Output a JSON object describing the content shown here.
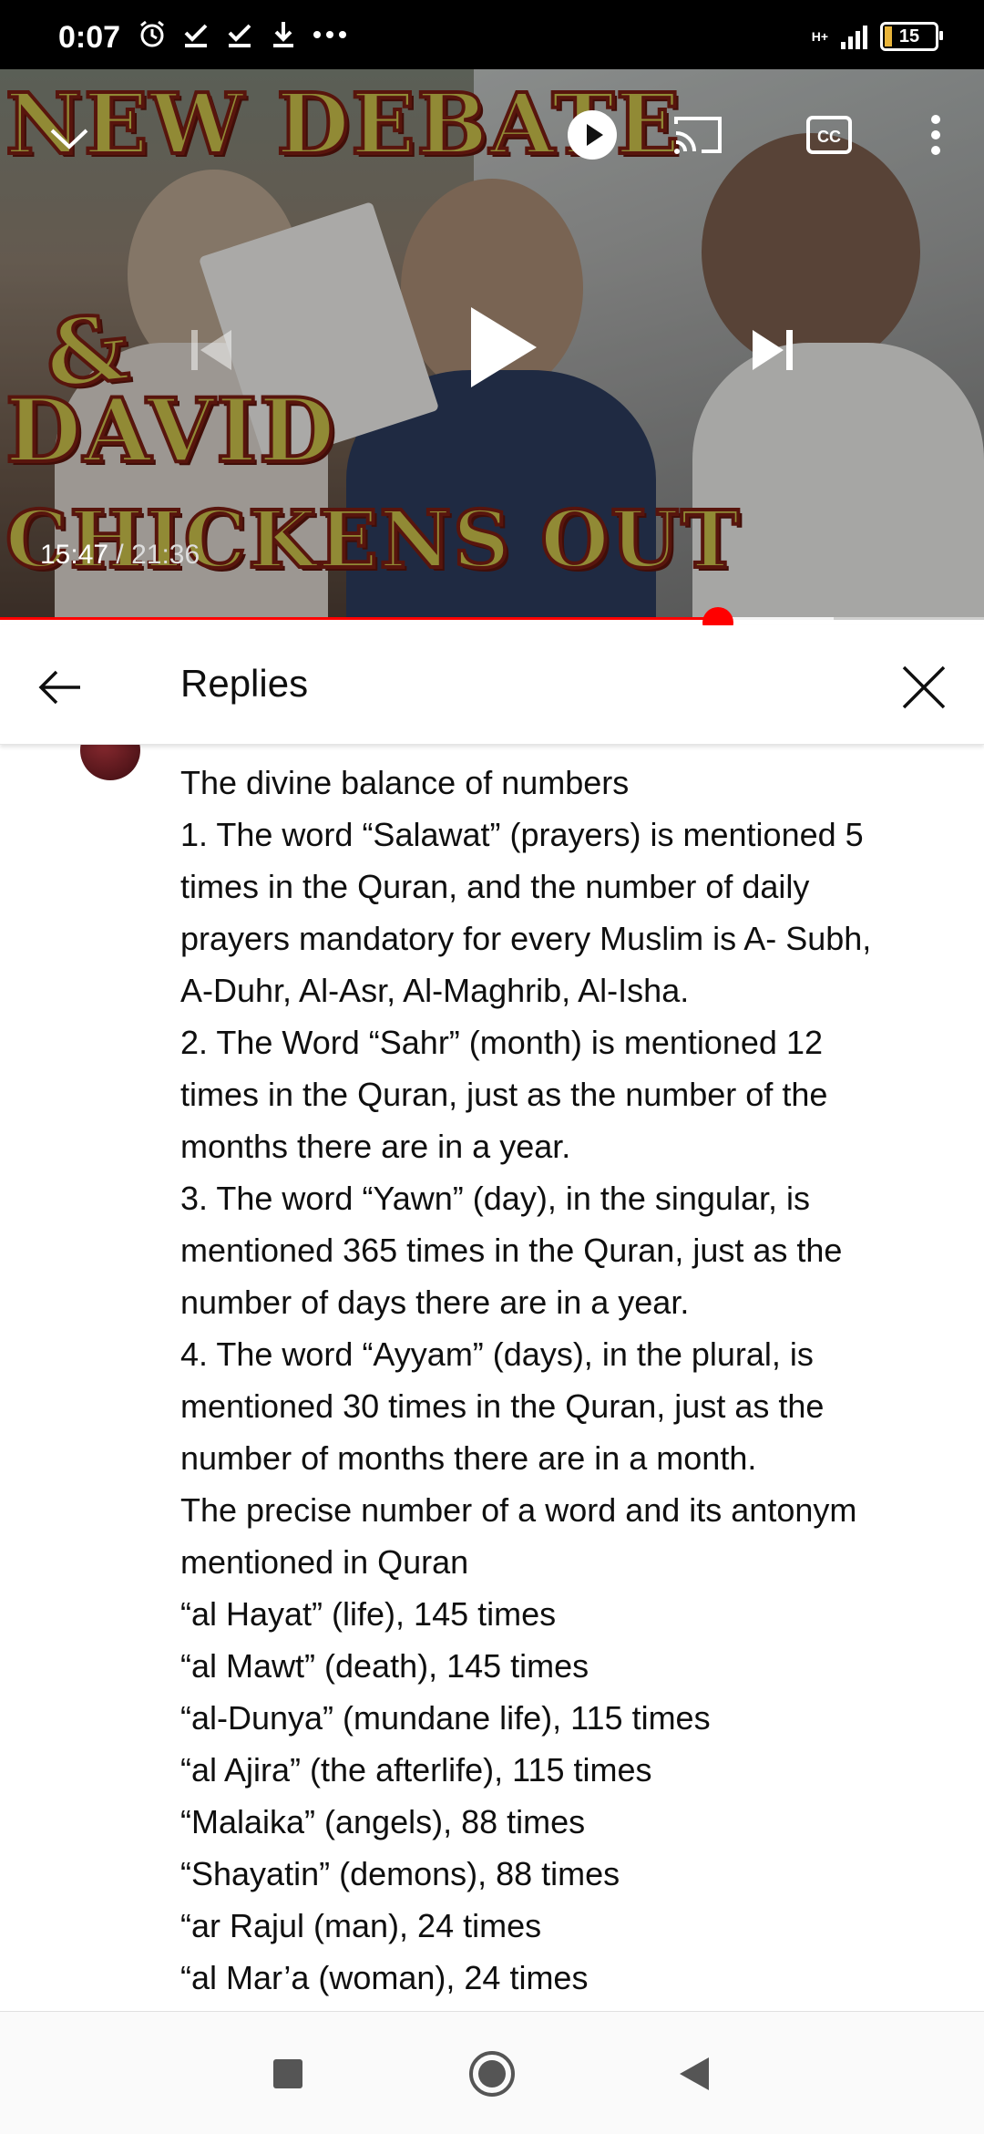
{
  "status_bar": {
    "time": "0:07",
    "network_label": "H+",
    "battery": "15",
    "battery_level": 0.15,
    "icons": [
      "alarm-icon",
      "download-done-icon",
      "download-done-icon",
      "download-icon",
      "more-dots-icon"
    ]
  },
  "video": {
    "thumbnail_text": [
      "NEW DEBATE",
      "&",
      "DAVID",
      "CHICKENS OUT"
    ],
    "current_time": "15:47",
    "separator": " / ",
    "duration": "21:36",
    "progress_fraction": 0.73,
    "buffered_fraction": 0.847,
    "colors": {
      "played": "#ff0000",
      "thumb_text": "#c9c04a",
      "thumb_stroke": "#7a1e12"
    }
  },
  "replies_panel": {
    "title": "Replies",
    "comment_lines": [
      "The divine balance of numbers",
      "1. The word “Salawat” (prayers) is mentioned 5",
      "times in the Quran, and the number of daily",
      "prayers mandatory for every Muslim is A- Subh,",
      "A-Duhr, Al-Asr, Al-Maghrib, Al-Isha.",
      "2. The Word “Sahr” (month) is mentioned 12",
      "times in the Quran, just as the number of the",
      "months there are in a year.",
      "3. The word “Yawn” (day), in the singular, is",
      "mentioned 365 times in the Quran, just as the",
      "number of days there are in a year.",
      "4. The word “Ayyam” (days), in the plural, is",
      "mentioned 30 times in the Quran, just as the",
      "number of months there are in a month.",
      "The precise number of a word and its antonym",
      "mentioned in Quran",
      "“al Hayat” (life), 145 times",
      "“al Mawt” (death), 145 times",
      "“al-Dunya” (mundane life), 115 times",
      "“al Ajira” (the afterlife), 115 times",
      "“Malaika” (angels), 88 times",
      "“Shayatin” (demons), 88 times",
      "“ar Rajul (man), 24 times",
      "“al Mar’a (woman), 24 times"
    ]
  }
}
